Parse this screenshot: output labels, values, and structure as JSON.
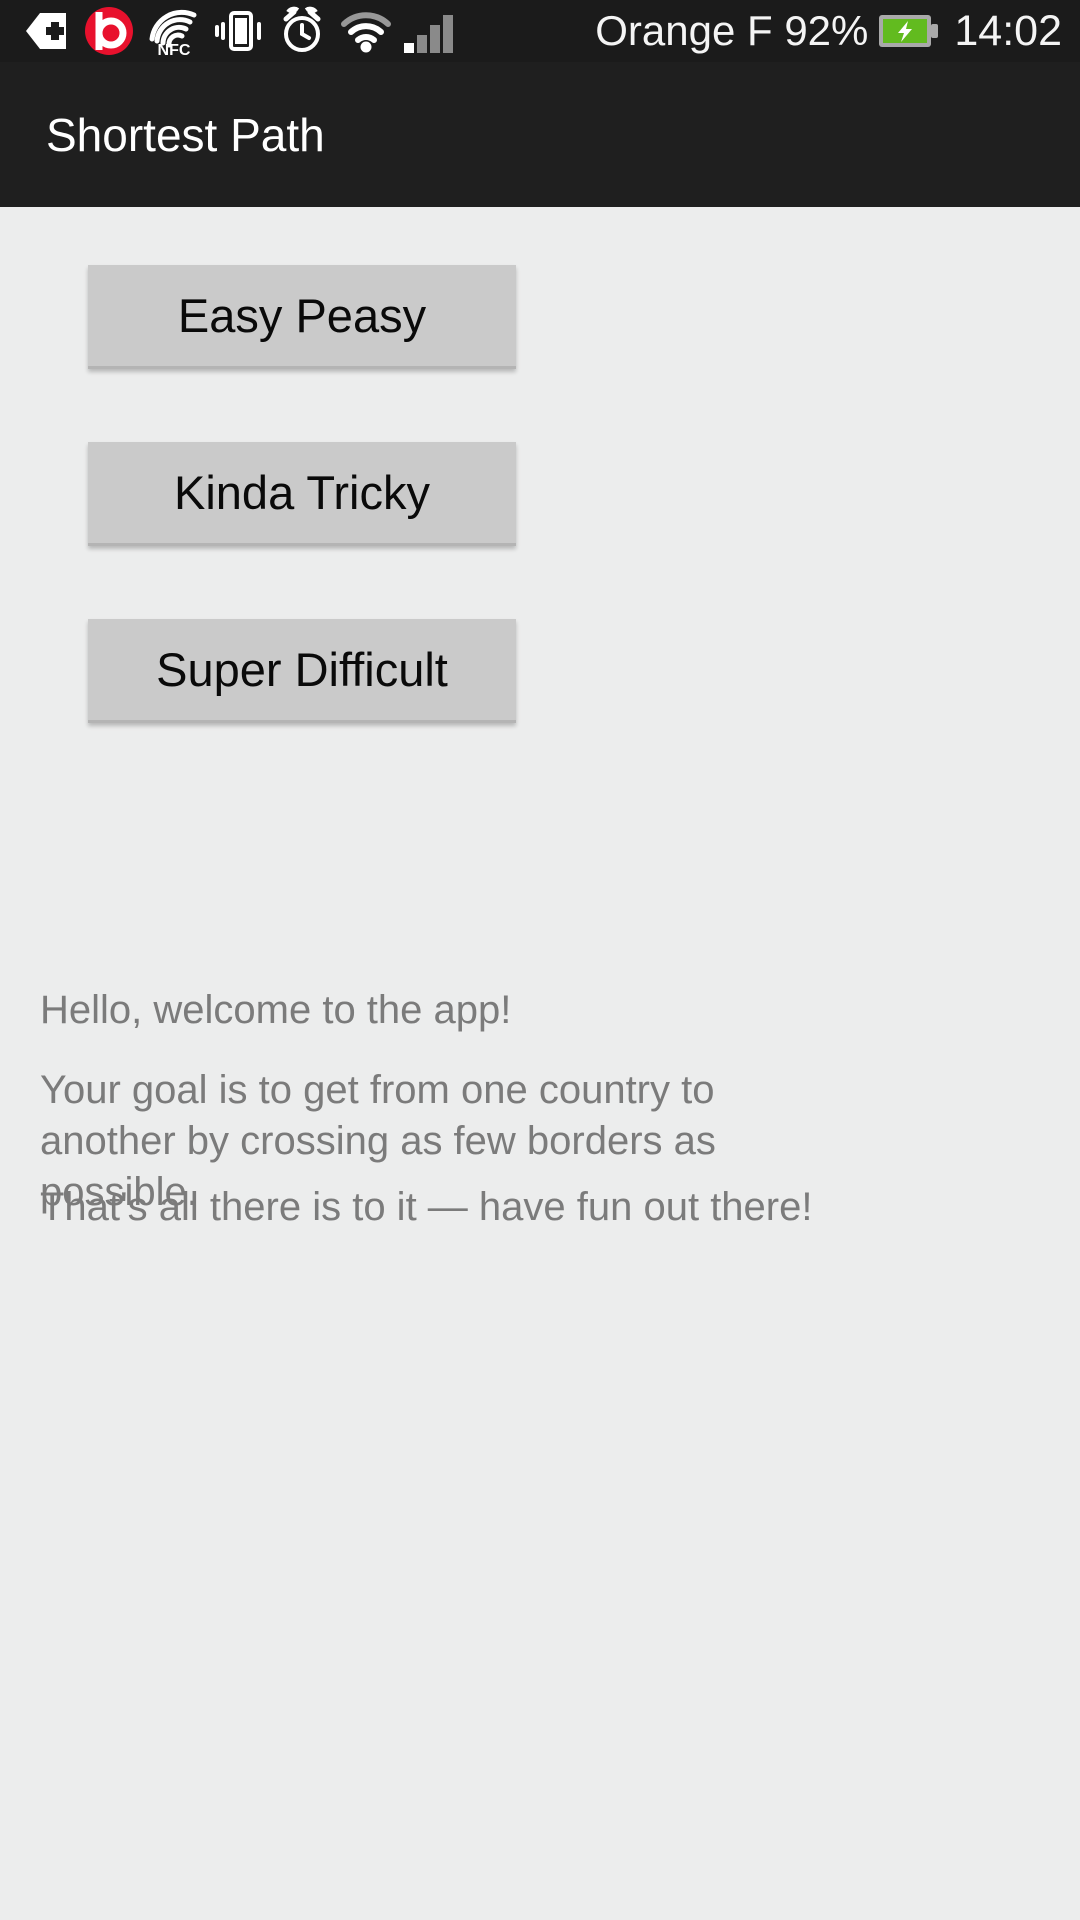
{
  "status_bar": {
    "background_color": "#1b1b1b",
    "icons": [
      {
        "name": "tag-plus-icon",
        "glyph": "tag-plus"
      },
      {
        "name": "beats-audio-icon",
        "glyph": "beats-b"
      },
      {
        "name": "nfc-icon",
        "glyph": "nfc",
        "label": "NFC"
      },
      {
        "name": "vibrate-icon",
        "glyph": "vibrate"
      },
      {
        "name": "alarm-clock-icon",
        "glyph": "alarm"
      },
      {
        "name": "wifi-icon",
        "glyph": "wifi"
      },
      {
        "name": "cellular-signal-icon",
        "glyph": "signal-bars"
      }
    ],
    "carrier_and_battery": "Orange F 92%",
    "battery": {
      "name": "battery-charging-icon",
      "level_percent": 92,
      "charging": true,
      "color": "#62bb1f"
    },
    "clock": "14:02"
  },
  "action_bar": {
    "title": "Shortest Path",
    "background_color": "#1f1f1f",
    "text_color": "#ffffff"
  },
  "main": {
    "background_color": "#eceded",
    "buttons": [
      {
        "label": "Easy Peasy",
        "name": "easy-peasy-button"
      },
      {
        "label": "Kinda Tricky",
        "name": "kinda-tricky-button"
      },
      {
        "label": "Super Difficult",
        "name": "super-difficult-button"
      }
    ],
    "button_color": "#cacaca",
    "paragraphs": [
      "Hello, welcome to the app!",
      "Your goal is to get from one country to another by crossing as few borders as possible.",
      "That's all there is to it — have fun out there!"
    ],
    "paragraph_color": "#7b7b7b"
  }
}
